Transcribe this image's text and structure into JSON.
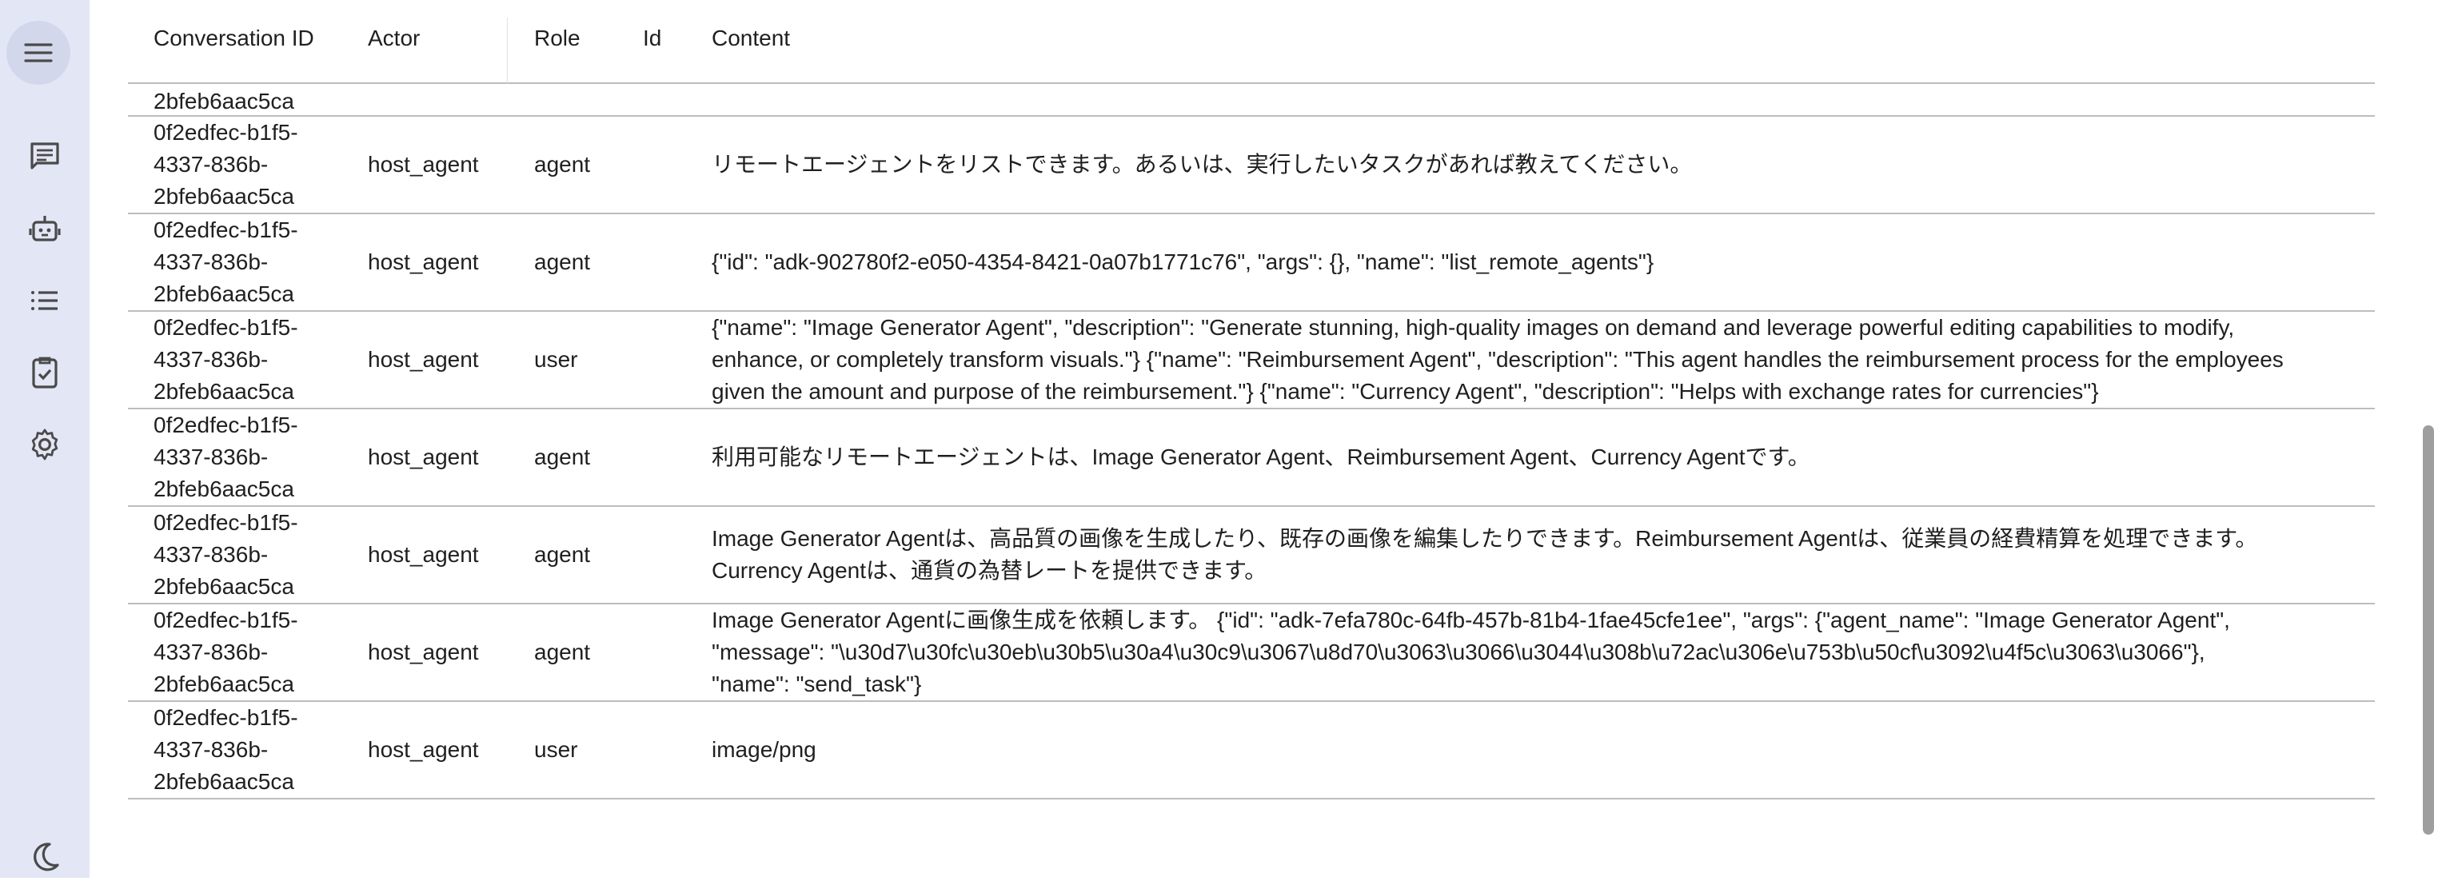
{
  "sidebar": {
    "items": [
      {
        "icon": "menu-icon"
      },
      {
        "icon": "chat-icon"
      },
      {
        "icon": "robot-icon"
      },
      {
        "icon": "list-icon"
      },
      {
        "icon": "task-check-icon"
      },
      {
        "icon": "gear-icon"
      },
      {
        "icon": "moon-icon"
      }
    ]
  },
  "table": {
    "headers": {
      "conversation_id": "Conversation ID",
      "actor": "Actor",
      "role": "Role",
      "id": "Id",
      "content": "Content"
    },
    "partial_row": {
      "conversation_id": "2bfeb6aac5ca"
    },
    "rows": [
      {
        "conversation_id": [
          "0f2edfec-b1f5-",
          "4337-836b-",
          "2bfeb6aac5ca"
        ],
        "actor": "host_agent",
        "role": "agent",
        "content": [
          "リモートエージェントをリストできます。あるいは、実行したいタスクがあれば教えてください。"
        ]
      },
      {
        "conversation_id": [
          "0f2edfec-b1f5-",
          "4337-836b-",
          "2bfeb6aac5ca"
        ],
        "actor": "host_agent",
        "role": "agent",
        "content": [
          "{\"id\": \"adk-902780f2-e050-4354-8421-0a07b1771c76\", \"args\": {}, \"name\": \"list_remote_agents\"}"
        ]
      },
      {
        "conversation_id": [
          "0f2edfec-b1f5-",
          "4337-836b-",
          "2bfeb6aac5ca"
        ],
        "actor": "host_agent",
        "role": "user",
        "content": [
          "{\"name\": \"Image Generator Agent\", \"description\": \"Generate stunning, high-quality images on demand and leverage powerful editing capabilities to modify,",
          "enhance, or completely transform visuals.\"} {\"name\": \"Reimbursement Agent\", \"description\": \"This agent handles the reimbursement process for the employees",
          "given the amount and purpose of the reimbursement.\"} {\"name\": \"Currency Agent\", \"description\": \"Helps with exchange rates for currencies\"}"
        ]
      },
      {
        "conversation_id": [
          "0f2edfec-b1f5-",
          "4337-836b-",
          "2bfeb6aac5ca"
        ],
        "actor": "host_agent",
        "role": "agent",
        "content": [
          "利用可能なリモートエージェントは、Image Generator Agent、Reimbursement Agent、Currency Agentです。"
        ]
      },
      {
        "conversation_id": [
          "0f2edfec-b1f5-",
          "4337-836b-",
          "2bfeb6aac5ca"
        ],
        "actor": "host_agent",
        "role": "agent",
        "content": [
          "Image Generator Agentは、高品質の画像を生成したり、既存の画像を編集したりできます。Reimbursement Agentは、従業員の経費精算を処理できます。",
          "Currency Agentは、通貨の為替レートを提供できます。"
        ]
      },
      {
        "conversation_id": [
          "0f2edfec-b1f5-",
          "4337-836b-",
          "2bfeb6aac5ca"
        ],
        "actor": "host_agent",
        "role": "agent",
        "content": [
          "Image Generator Agentに画像生成を依頼します。 {\"id\": \"adk-7efa780c-64fb-457b-81b4-1fae45cfe1ee\", \"args\": {\"agent_name\": \"Image Generator Agent\",",
          "\"message\": \"\\u30d7\\u30fc\\u30eb\\u30b5\\u30a4\\u30c9\\u3067\\u8d70\\u3063\\u3066\\u3044\\u308b\\u72ac\\u306e\\u753b\\u50cf\\u3092\\u4f5c\\u3063\\u3066\"},",
          "\"name\": \"send_task\"}"
        ]
      },
      {
        "conversation_id": [
          "0f2edfec-b1f5-",
          "4337-836b-",
          "2bfeb6aac5ca"
        ],
        "actor": "host_agent",
        "role": "user",
        "content": [
          "image/png"
        ]
      }
    ]
  }
}
